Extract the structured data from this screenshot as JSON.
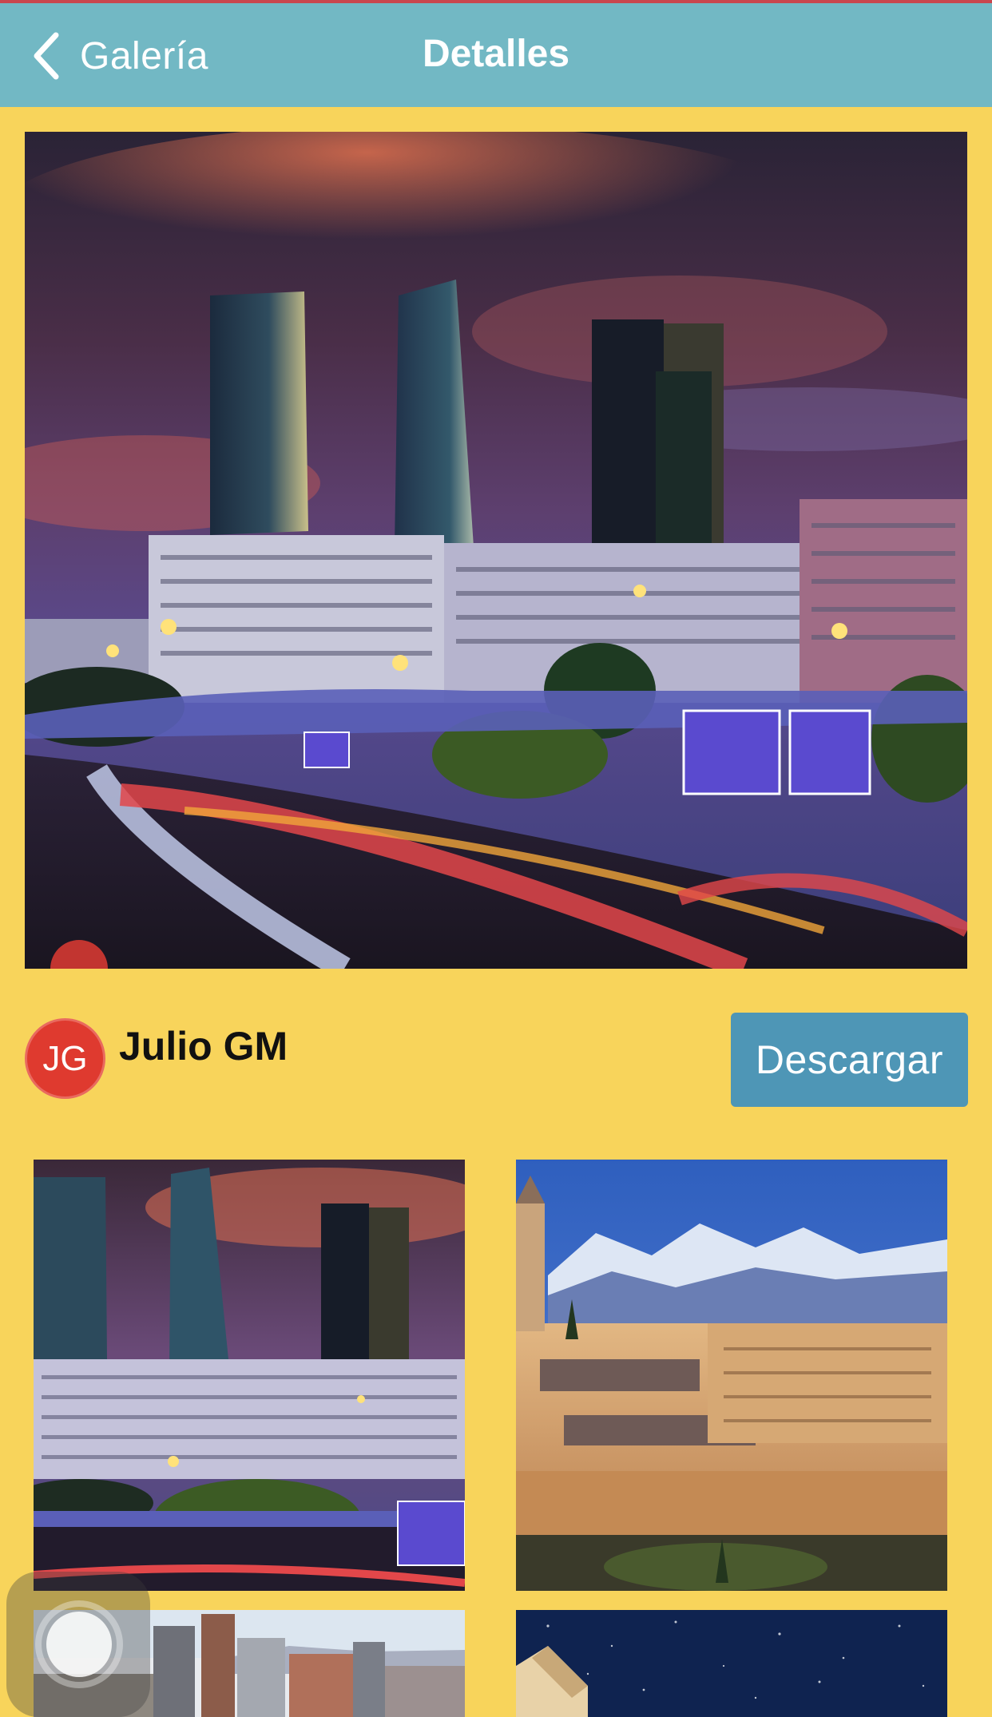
{
  "navbar": {
    "back_label": "Galería",
    "title": "Detalles"
  },
  "author": {
    "initials": "JG",
    "name": "Julio GM"
  },
  "actions": {
    "download_label": "Descargar"
  },
  "colors": {
    "navbar": "#72B8C4",
    "background": "#F8D45B",
    "avatar": "#DF3A2F",
    "download_button": "#4E96B6"
  },
  "gallery": {
    "thumbnails": [
      {
        "subject": "madrid-skyline-night"
      },
      {
        "subject": "alhambra-granada-dusk"
      },
      {
        "subject": "city-skyline-day"
      },
      {
        "subject": "starry-night-building"
      }
    ]
  },
  "icons": {
    "back": "chevron-left-icon",
    "assistive_touch": "assistive-touch-icon"
  }
}
